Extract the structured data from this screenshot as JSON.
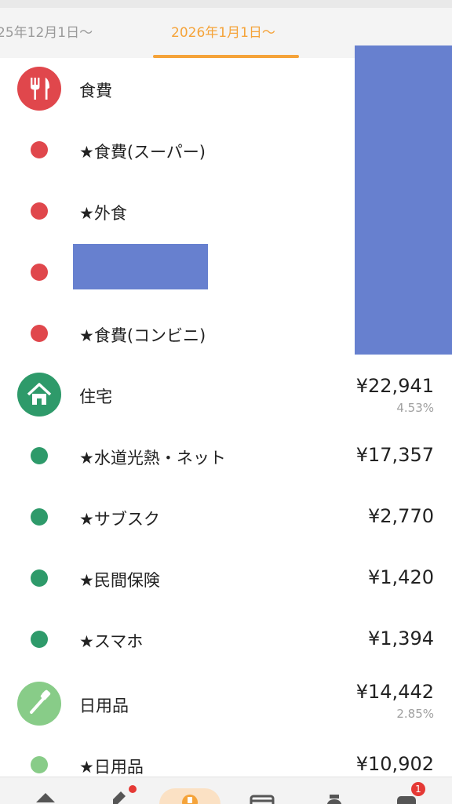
{
  "tabs": [
    {
      "label": "25年12月1日〜"
    },
    {
      "label": "2026年1月1日〜",
      "active": true
    }
  ],
  "colors": {
    "accent": "#f5a339",
    "food": "#e0474c",
    "housing": "#2e9a6a",
    "daily": "#88cc88",
    "redaction": "#6780cf",
    "percent_text": "#a0a0a0"
  },
  "categories": [
    {
      "name": "食費",
      "icon": "fork-knife-icon",
      "color": "#e0474c",
      "amount": "",
      "percent": "",
      "items": [
        {
          "name": "★食費(スーパー)",
          "amount": ""
        },
        {
          "name": "★外食",
          "amount": ""
        },
        {
          "name": "",
          "amount": ""
        },
        {
          "name": "★食費(コンビニ)",
          "amount": ""
        }
      ]
    },
    {
      "name": "住宅",
      "icon": "house-icon",
      "color": "#2e9a6a",
      "amount": "¥22,941",
      "percent": "4.53%",
      "items": [
        {
          "name": "★水道光熱・ネット",
          "amount": "¥17,357"
        },
        {
          "name": "★サブスク",
          "amount": "¥2,770"
        },
        {
          "name": "★民間保険",
          "amount": "¥1,420"
        },
        {
          "name": "★スマホ",
          "amount": "¥1,394"
        }
      ]
    },
    {
      "name": "日用品",
      "icon": "toothbrush-icon",
      "color": "#88cc88",
      "amount": "¥14,442",
      "percent": "2.85%",
      "items": [
        {
          "name": "★日用品",
          "amount": "¥10,902"
        }
      ]
    }
  ],
  "bottom_nav": {
    "items": [
      {
        "icon": "home-icon"
      },
      {
        "icon": "edit-icon"
      },
      {
        "icon": "wallet-icon"
      },
      {
        "icon": "card-icon"
      },
      {
        "icon": "money-bag-icon"
      },
      {
        "icon": "notification-icon"
      }
    ],
    "notification_badge": "1"
  }
}
